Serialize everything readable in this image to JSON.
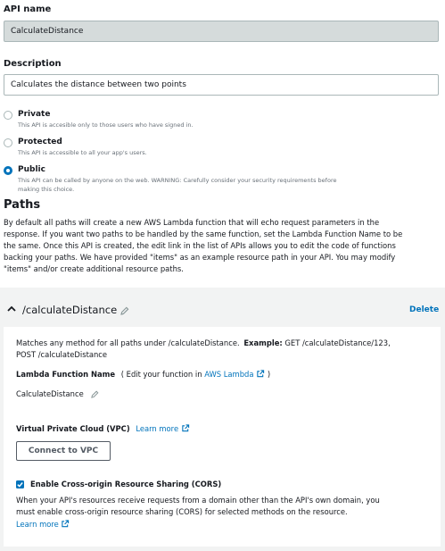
{
  "api_name": {
    "label": "API name",
    "value": "CalculateDistance"
  },
  "description": {
    "label": "Description",
    "value": "Calculates the distance between two points"
  },
  "visibility": {
    "options": [
      {
        "title": "Private",
        "desc": "This API is accesible only to those users who have signed in.",
        "checked": false
      },
      {
        "title": "Protected",
        "desc": "This API is accessible to all your app's users.",
        "checked": false
      },
      {
        "title": "Public",
        "desc_line1": "This API can be called by anyone on the web. WARNING: Carefully consider your security requirements before",
        "desc_line2": "making this choice.",
        "checked": true
      }
    ]
  },
  "paths": {
    "title": "Paths",
    "desc_lines": [
      "By default all paths will create a new AWS Lambda function that will echo request parameters in the",
      "response. If you want two paths to be handled by the same function, set the Lambda Function Name to be",
      "the same. Once this API is created, the edit link in the list of APIs allows you to edit the code of functions",
      "backing your paths. We have provided \"items\" as an example resource path in your API. You may modify",
      "\"items\" and/or create additional resource paths."
    ]
  },
  "resource": {
    "path": "/calculateDistance",
    "delete_label": "Delete",
    "match_text": "Matches any method for all paths under /calculateDistance.",
    "example_label": "Example:",
    "example_text": "GET /calculateDistance/123,",
    "example_line2": "POST /calculateDistance",
    "lambda_label": "Lambda Function Name",
    "lambda_hint_prefix": "( Edit your function in",
    "lambda_link": "AWS Lambda",
    "lambda_hint_suffix": ")",
    "lambda_value": "CalculateDistance",
    "vpc_label": "Virtual Private Cloud (VPC)",
    "vpc_learn_more": "Learn more",
    "connect_vpc": "Connect to VPC",
    "cors_label": "Enable Cross-origin Resource Sharing (CORS)",
    "cors_checked": true,
    "cors_desc_line1": "When your API's resources receive requests from a domain other than the API's own domain, you",
    "cors_desc_line2": "must enable cross-origin resource sharing (CORS) for selected methods on the resource.",
    "cors_learn_more": "Learn more"
  },
  "colors": {
    "link": "#0073bb",
    "text": "#16191f",
    "muted": "#687078",
    "panel": "#f2f3f3",
    "disabled_input": "#d5dbdb"
  }
}
